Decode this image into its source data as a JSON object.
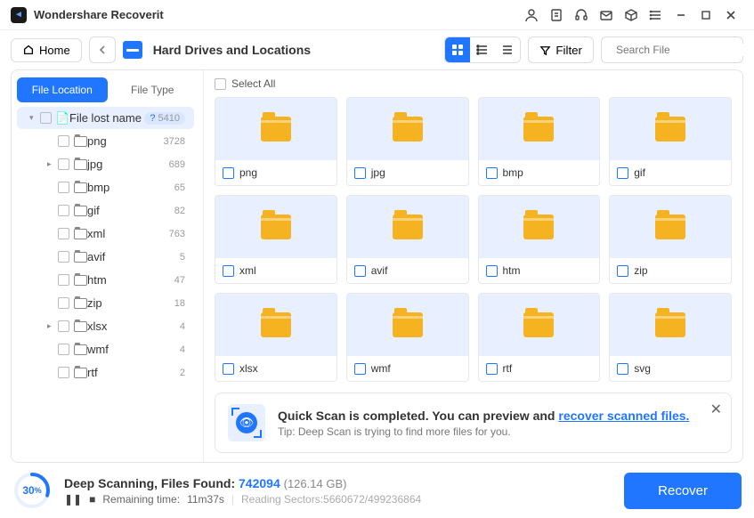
{
  "app": {
    "title": "Wondershare Recoverit"
  },
  "toolbar": {
    "home": "Home",
    "location": "Hard Drives and Locations",
    "filter": "Filter",
    "search_placeholder": "Search File"
  },
  "sidebar": {
    "tabs": [
      "File Location",
      "File Type"
    ],
    "root": {
      "label": "File lost name",
      "count": "5410"
    },
    "items": [
      {
        "label": "png",
        "count": "3728",
        "exp": ""
      },
      {
        "label": "jpg",
        "count": "689",
        "exp": "▸"
      },
      {
        "label": "bmp",
        "count": "65",
        "exp": ""
      },
      {
        "label": "gif",
        "count": "82",
        "exp": ""
      },
      {
        "label": "xml",
        "count": "763",
        "exp": ""
      },
      {
        "label": "avif",
        "count": "5",
        "exp": ""
      },
      {
        "label": "htm",
        "count": "47",
        "exp": ""
      },
      {
        "label": "zip",
        "count": "18",
        "exp": ""
      },
      {
        "label": "xlsx",
        "count": "4",
        "exp": "▸"
      },
      {
        "label": "wmf",
        "count": "4",
        "exp": ""
      },
      {
        "label": "rtf",
        "count": "2",
        "exp": ""
      }
    ]
  },
  "content": {
    "select_all": "Select All",
    "folders": [
      "png",
      "jpg",
      "bmp",
      "gif",
      "xml",
      "avif",
      "htm",
      "zip",
      "xlsx",
      "wmf",
      "rtf",
      "svg"
    ]
  },
  "notification": {
    "title_pre": "Quick Scan is completed. You can preview and ",
    "title_link": "recover scanned files.",
    "tip": "Tip: Deep Scan is trying to find more files for you."
  },
  "footer": {
    "progress": "30",
    "progress_label": "%",
    "status_label": "Deep Scanning, Files Found: ",
    "files_found": "742094",
    "size": "(126.14 GB)",
    "remaining_label": "Remaining time:",
    "remaining_value": "11m37s",
    "sectors": "Reading Sectors:5660672/499236864",
    "recover": "Recover"
  }
}
